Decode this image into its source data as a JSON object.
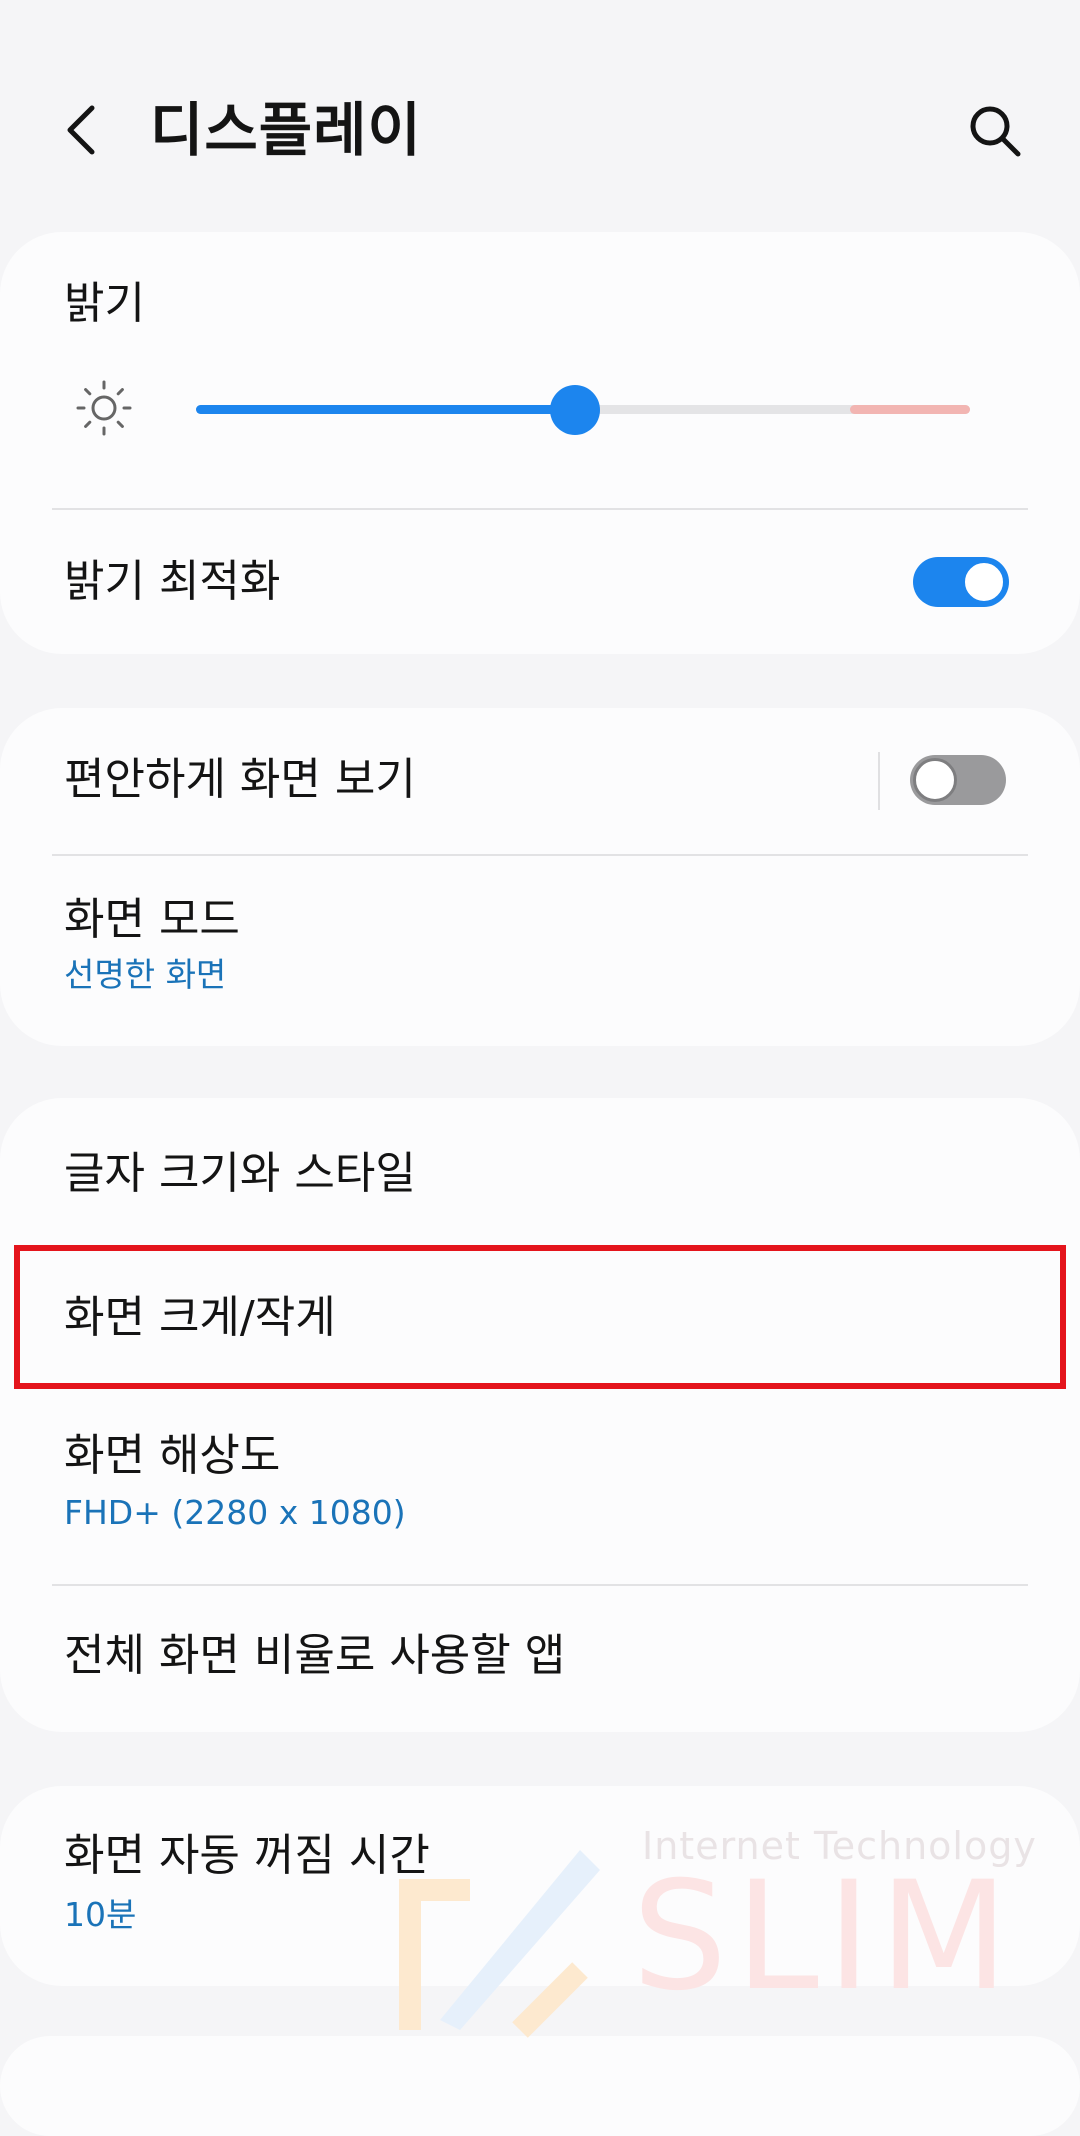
{
  "header": {
    "title": "디스플레이",
    "back_icon": "chevron-left-icon",
    "search_icon": "search-icon"
  },
  "brightness": {
    "title": "밝기",
    "icon": "sun-icon",
    "level": 0.49,
    "accent_color": "#1c85ee",
    "high_zone_color": "#f2b5b2"
  },
  "adaptive_brightness": {
    "title": "밝기 최적화",
    "enabled": true
  },
  "eye_comfort": {
    "title": "편안하게 화면 보기",
    "enabled": false
  },
  "screen_mode": {
    "title": "화면 모드",
    "value": "선명한 화면"
  },
  "font_size_style": {
    "title": "글자 크기와 스타일"
  },
  "screen_zoom": {
    "title": "화면 크게/작게",
    "highlight_color": "#e4141c"
  },
  "screen_resolution": {
    "title": "화면 해상도",
    "value": "FHD+ (2280 x 1080)"
  },
  "fullscreen_apps": {
    "title": "전체 화면 비율로 사용할 앱"
  },
  "screen_timeout": {
    "title": "화면 자동 꺼짐 시간",
    "value": "10분"
  },
  "watermark": {
    "tagline": "Internet Technology",
    "logo": "SLIM"
  }
}
